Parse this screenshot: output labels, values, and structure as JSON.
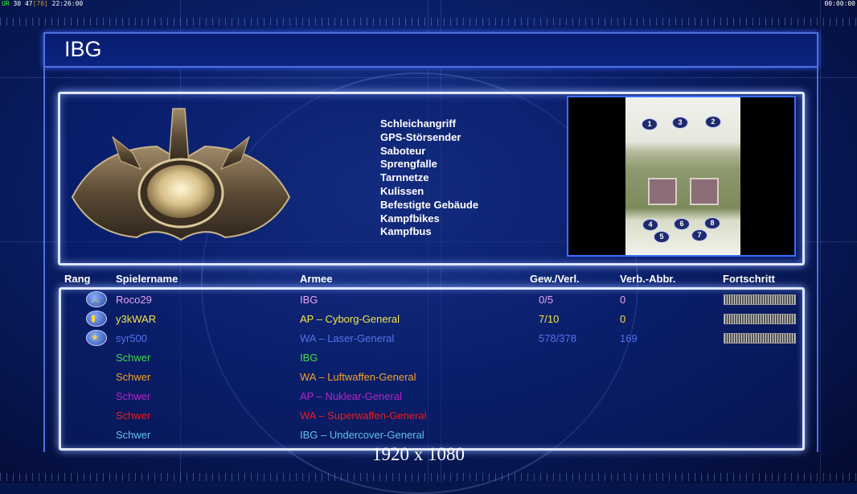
{
  "status_left": {
    "a": "UR",
    "b": "30",
    "c": "47",
    "d": "[70]",
    "time": "22:26:00"
  },
  "status_right": "00:00:00",
  "title": "IBG",
  "abilities": [
    "Schleichangriff",
    "GPS-Störsender",
    "Saboteur",
    "Sprengfalle",
    "Tarnnetze",
    "Kulissen",
    "Befestigte Gebäude",
    "Kampfbikes",
    "Kampfbus"
  ],
  "map_spots": [
    "1",
    "3",
    "2",
    "4",
    "6",
    "8",
    "5",
    "7"
  ],
  "columns": {
    "rank": "Rang",
    "player": "Spielername",
    "army": "Armee",
    "winloss": "Gew./Verl.",
    "disc": "Verb.-Abbr.",
    "progress": "Fortschritt"
  },
  "players": [
    {
      "name": "Roco29",
      "army": "IBG",
      "winloss": "0/5",
      "disc": "0",
      "color": "#e7a4f0",
      "stat_color": "#e7a4f0",
      "rank_icon": "chevron-rank-icon",
      "rank_glyph": "︿",
      "progress": 1.0
    },
    {
      "name": "y3kWAR",
      "army": "AP – Cyborg-General",
      "winloss": "7/10",
      "disc": "0",
      "color": "#f4e24a",
      "stat_color": "#f4e24a",
      "rank_icon": "bar-rank-icon",
      "rank_glyph": "▮",
      "progress": 1.0
    },
    {
      "name": "syr500",
      "army": "WA – Laser-General",
      "winloss": "578/378",
      "disc": "169",
      "color": "#5472e8",
      "stat_color": "#5472e8",
      "rank_icon": "star-rank-icon",
      "rank_glyph": "★",
      "progress": 1.0
    },
    {
      "name": "Schwer",
      "army": "IBG",
      "color": "#41d84a"
    },
    {
      "name": "Schwer",
      "army": "WA – Luftwaffen-General",
      "color": "#f2a126"
    },
    {
      "name": "Schwer",
      "army": "AP – Nuklear-General",
      "color": "#b427c8"
    },
    {
      "name": "Schwer",
      "army": "WA – Superwaffen-General",
      "color": "#ee1c1c"
    },
    {
      "name": "Schwer",
      "army": "IBG – Undercover-General",
      "color": "#5fc1f0"
    }
  ],
  "resolution": "1920 x 1080"
}
